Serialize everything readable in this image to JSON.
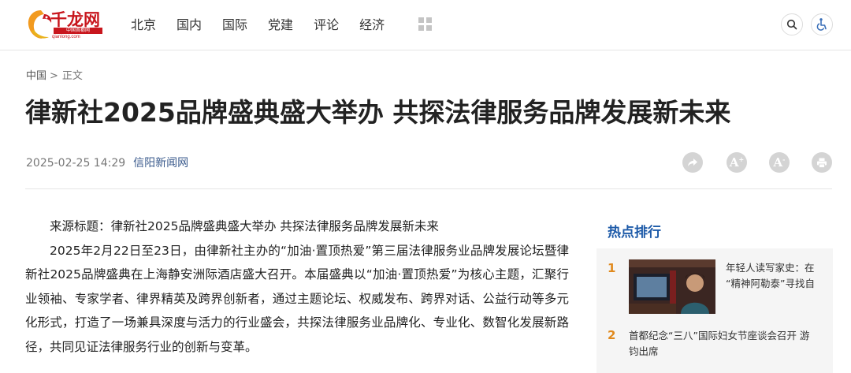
{
  "header": {
    "logo": {
      "name": "千龙网",
      "tagline": "中国首都网",
      "url": "qianlong.com"
    },
    "nav": [
      "北京",
      "国内",
      "国际",
      "党建",
      "评论",
      "经济"
    ],
    "more_icon": "grid-icon",
    "search_icon": "search-icon",
    "accessibility_icon": "wheelchair-icon"
  },
  "breadcrumb": {
    "home": "中国",
    "separator": ">",
    "current": "正文"
  },
  "article": {
    "title": "律新社2025品牌盛典盛大举办 共探法律服务品牌发展新未来",
    "date": "2025-02-25 14:29",
    "source": "信阳新闻网",
    "tools": [
      "share-icon",
      "font-larger-icon",
      "font-smaller-icon",
      "print-icon"
    ],
    "paragraphs": [
      "来源标题：律新社2025品牌盛典盛大举办 共探法律服务品牌发展新未来",
      "2025年2月22日至23日，由律新社主办的“加油·置顶热爱”第三届法律服务业品牌发展论坛暨律新社2025品牌盛典在上海静安洲际酒店盛大召开。本届盛典以“加油·置顶热爱”为核心主题，汇聚行业领袖、专家学者、律界精英及跨界创新者，通过主题论坛、权威发布、跨界对话、公益行动等多元化形式，打造了一场兼具深度与活力的行业盛会，共探法律服务业品牌化、专业化、数智化发展新路径，共同见证法律服务行业的创新与变革。"
    ]
  },
  "sidebar": {
    "title": "热点排行",
    "items": [
      {
        "rank": "1",
        "text_line1": "年轻人读写家史：在",
        "text_line2": "“精神阿勒泰”寻找自"
      },
      {
        "rank": "2",
        "text_line1": "首都纪念“三八”国际妇女节座谈会召开 游",
        "text_line2": "钧出席"
      }
    ]
  },
  "colors": {
    "brand_red": "#c8161d",
    "link_blue": "#1d5aa8",
    "rank_orange": "#e08a1e"
  }
}
